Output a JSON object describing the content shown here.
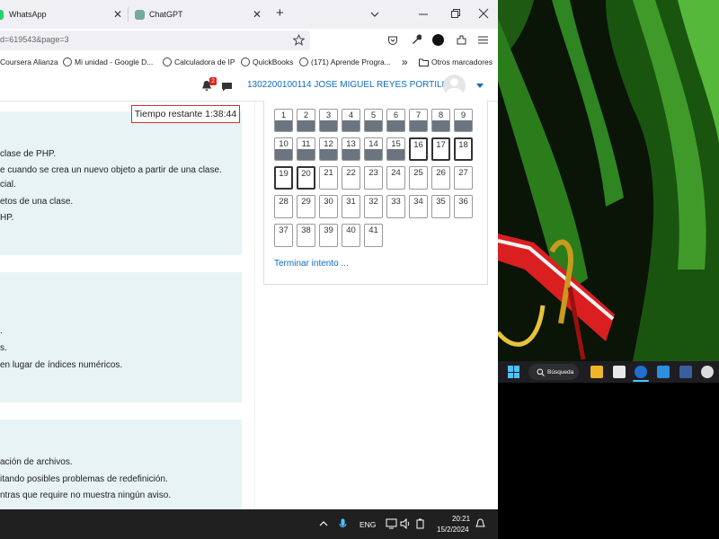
{
  "browser": {
    "tabs": [
      {
        "label": "WhatsApp"
      },
      {
        "label": "ChatGPT"
      }
    ],
    "new_tab": "+",
    "tab_close": "✕",
    "address": "d=619543&page=3",
    "bookmarks": [
      {
        "label": "Coursera Alianza"
      },
      {
        "label": "Mi unidad - Google D..."
      },
      {
        "label": "Calculadora de IP"
      },
      {
        "label": "QuickBooks"
      },
      {
        "label": "(171) Aprende Progra..."
      }
    ],
    "bookmarks_more": "»",
    "other_bookmarks": "Otros marcadores"
  },
  "header": {
    "notification_count": "2",
    "user_name": "1302200100114 JOSE MIGUEL REYES PORTILLO"
  },
  "timer": "Tiempo restante 1:38:44",
  "questions": {
    "q1_lines": [
      "clase de PHP.",
      "e cuando se crea un nuevo objeto a partir de una clase.",
      "cial.",
      "etos de una clase.",
      "HP."
    ],
    "q2_lines": [
      ".",
      "s.",
      "en lugar de índices numéricos."
    ],
    "q3_lines": [
      "ación de archivos.",
      "itando posibles problemas de redefinición.",
      "ntras que require no muestra ningún aviso."
    ]
  },
  "quiz_nav": {
    "buttons": [
      "1",
      "2",
      "3",
      "4",
      "5",
      "6",
      "7",
      "8",
      "9",
      "10",
      "11",
      "12",
      "13",
      "14",
      "15",
      "16",
      "17",
      "18",
      "19",
      "20",
      "21",
      "22",
      "23",
      "24",
      "25",
      "26",
      "27",
      "28",
      "29",
      "30",
      "31",
      "32",
      "33",
      "34",
      "35",
      "36",
      "37",
      "38",
      "39",
      "40",
      "41"
    ],
    "finish_link": "Terminar intento ..."
  },
  "taskbar_left": {
    "language": "ENG",
    "time": "20:21",
    "date": "15/2/2024"
  },
  "taskbar_right": {
    "search_label": "Búsqueda"
  },
  "colors": {
    "accent_blue": "#0f6cbf",
    "card_bg": "#e7f3f5",
    "answered": "#6b7580",
    "timer_border": "#cc3333"
  }
}
